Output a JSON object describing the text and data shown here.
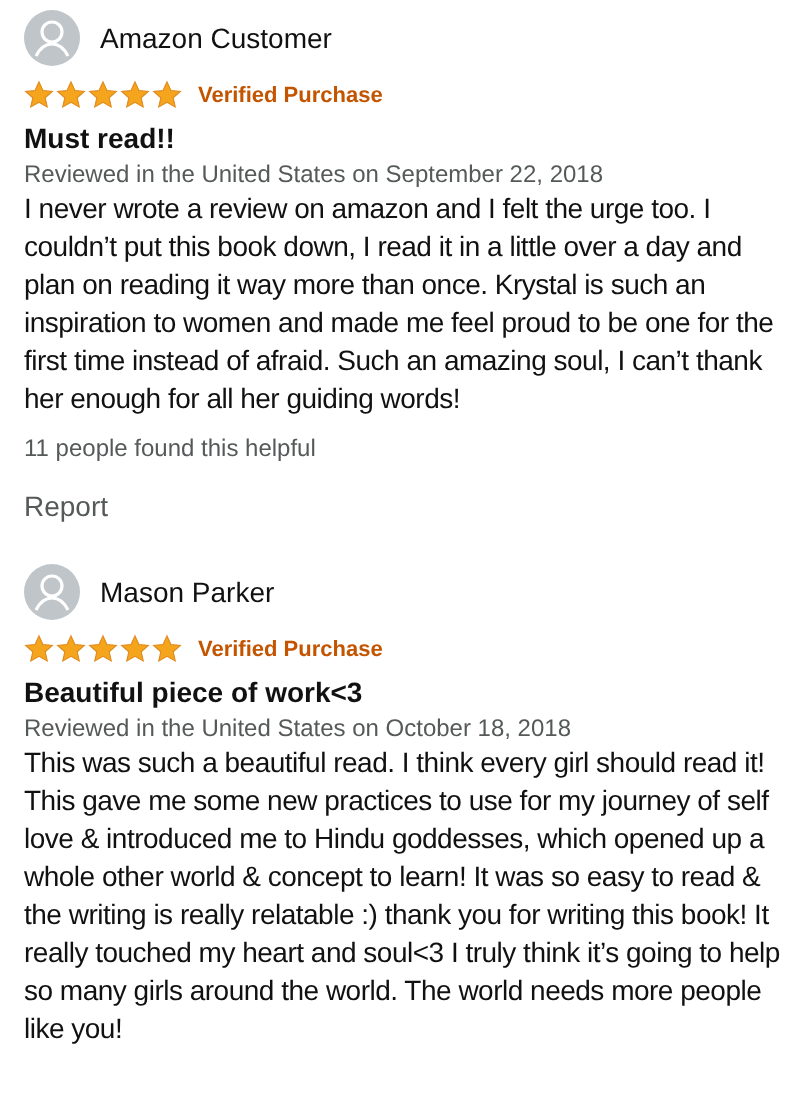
{
  "reviews": [
    {
      "author": "Amazon Customer",
      "stars": 5,
      "badge": "Verified Purchase",
      "title": "Must read!!",
      "meta": "Reviewed in the United States on September 22, 2018",
      "body": "I never wrote a review on amazon and I felt the urge too. I couldn’t put this book down, I read it in a little over a day and plan on reading it way more than once. Krystal is such an inspiration to women and made me feel proud to be one for the first time instead of afraid. Such an amazing soul, I can’t thank her enough for all her guiding words!",
      "helpful": "11 people found this helpful",
      "report": "Report"
    },
    {
      "author": "Mason Parker",
      "stars": 5,
      "badge": "Verified Purchase",
      "title": "Beautiful piece of work<3",
      "meta": "Reviewed in the United States on October 18, 2018",
      "body": "This was such a beautiful read. I think every girl should read it! This gave me some new practices to use for my journey of self love & introduced me to Hindu goddesses, which opened up a whole other world & concept to learn! It was so easy to read & the writing is really relatable :) thank you for writing this book! It really touched my heart and soul<3 I truly think it’s going to help so many girls around the world. The world needs more people like you!"
    }
  ]
}
